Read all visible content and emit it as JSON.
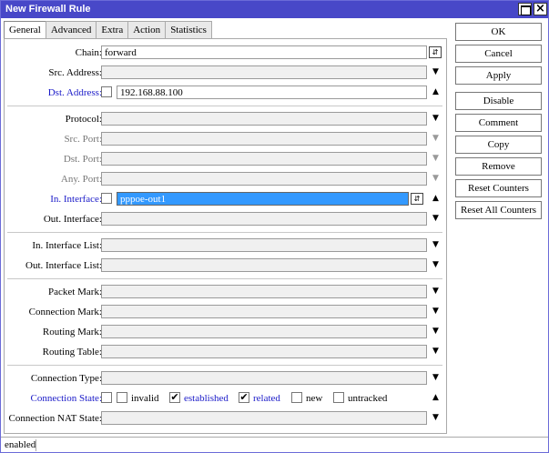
{
  "window": {
    "title": "New Firewall Rule",
    "close_glyph": "×"
  },
  "tabs": [
    "General",
    "Advanced",
    "Extra",
    "Action",
    "Statistics"
  ],
  "form": {
    "chain": {
      "label": "Chain:",
      "value": "forward"
    },
    "src_address": {
      "label": "Src. Address:",
      "value": ""
    },
    "dst_address": {
      "label": "Dst. Address:",
      "value": "192.168.88.100"
    },
    "protocol": {
      "label": "Protocol:",
      "value": ""
    },
    "src_port": {
      "label": "Src. Port:",
      "value": ""
    },
    "dst_port": {
      "label": "Dst. Port:",
      "value": ""
    },
    "any_port": {
      "label": "Any. Port:",
      "value": ""
    },
    "in_interface": {
      "label": "In. Interface:",
      "value": "pppoe-out1"
    },
    "out_interface": {
      "label": "Out. Interface:",
      "value": ""
    },
    "in_interface_list": {
      "label": "In. Interface List:",
      "value": ""
    },
    "out_interface_list": {
      "label": "Out. Interface List:",
      "value": ""
    },
    "packet_mark": {
      "label": "Packet Mark:",
      "value": ""
    },
    "connection_mark": {
      "label": "Connection Mark:",
      "value": ""
    },
    "routing_mark": {
      "label": "Routing Mark:",
      "value": ""
    },
    "routing_table": {
      "label": "Routing Table:",
      "value": ""
    },
    "connection_type": {
      "label": "Connection Type:",
      "value": ""
    },
    "connection_state": {
      "label": "Connection State:",
      "options": [
        {
          "label": "invalid",
          "checked": false
        },
        {
          "label": "established",
          "checked": true
        },
        {
          "label": "related",
          "checked": true
        },
        {
          "label": "new",
          "checked": false
        },
        {
          "label": "untracked",
          "checked": false
        }
      ]
    },
    "connection_nat_state": {
      "label": "Connection NAT State:",
      "value": ""
    }
  },
  "buttons": [
    "OK",
    "Cancel",
    "Apply",
    "Disable",
    "Comment",
    "Copy",
    "Remove",
    "Reset Counters",
    "Reset All Counters"
  ],
  "status": "enabled",
  "icons": {
    "dropdown": "▼",
    "collapse": "▲",
    "combo": "⇵",
    "check": "✔"
  },
  "colors": {
    "titlebar": "#4848c8",
    "highlight": "#3399ff",
    "label_blue": "#1a1ac8"
  }
}
